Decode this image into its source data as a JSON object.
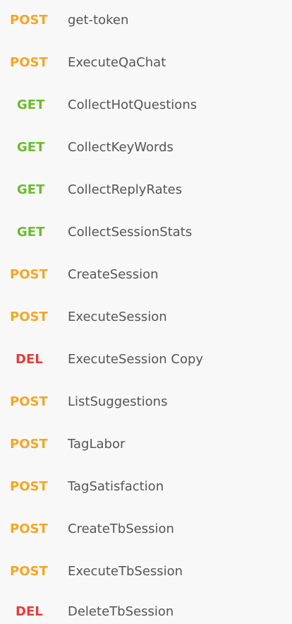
{
  "requests": [
    {
      "method": "POST",
      "name": "get-token"
    },
    {
      "method": "POST",
      "name": "ExecuteQaChat"
    },
    {
      "method": "GET",
      "name": "CollectHotQuestions"
    },
    {
      "method": "GET",
      "name": "CollectKeyWords"
    },
    {
      "method": "GET",
      "name": "CollectReplyRates"
    },
    {
      "method": "GET",
      "name": "CollectSessionStats"
    },
    {
      "method": "POST",
      "name": "CreateSession"
    },
    {
      "method": "POST",
      "name": "ExecuteSession"
    },
    {
      "method": "DEL",
      "name": "ExecuteSession Copy"
    },
    {
      "method": "POST",
      "name": "ListSuggestions"
    },
    {
      "method": "POST",
      "name": "TagLabor"
    },
    {
      "method": "POST",
      "name": "TagSatisfaction"
    },
    {
      "method": "POST",
      "name": "CreateTbSession"
    },
    {
      "method": "POST",
      "name": "ExecuteTbSession"
    },
    {
      "method": "DEL",
      "name": "DeleteTbSession"
    }
  ],
  "colors": {
    "POST": "#f5a623",
    "GET": "#6bbd2a",
    "DEL": "#e83b3b",
    "name_text": "#555555",
    "background": "#f8f8f8"
  }
}
